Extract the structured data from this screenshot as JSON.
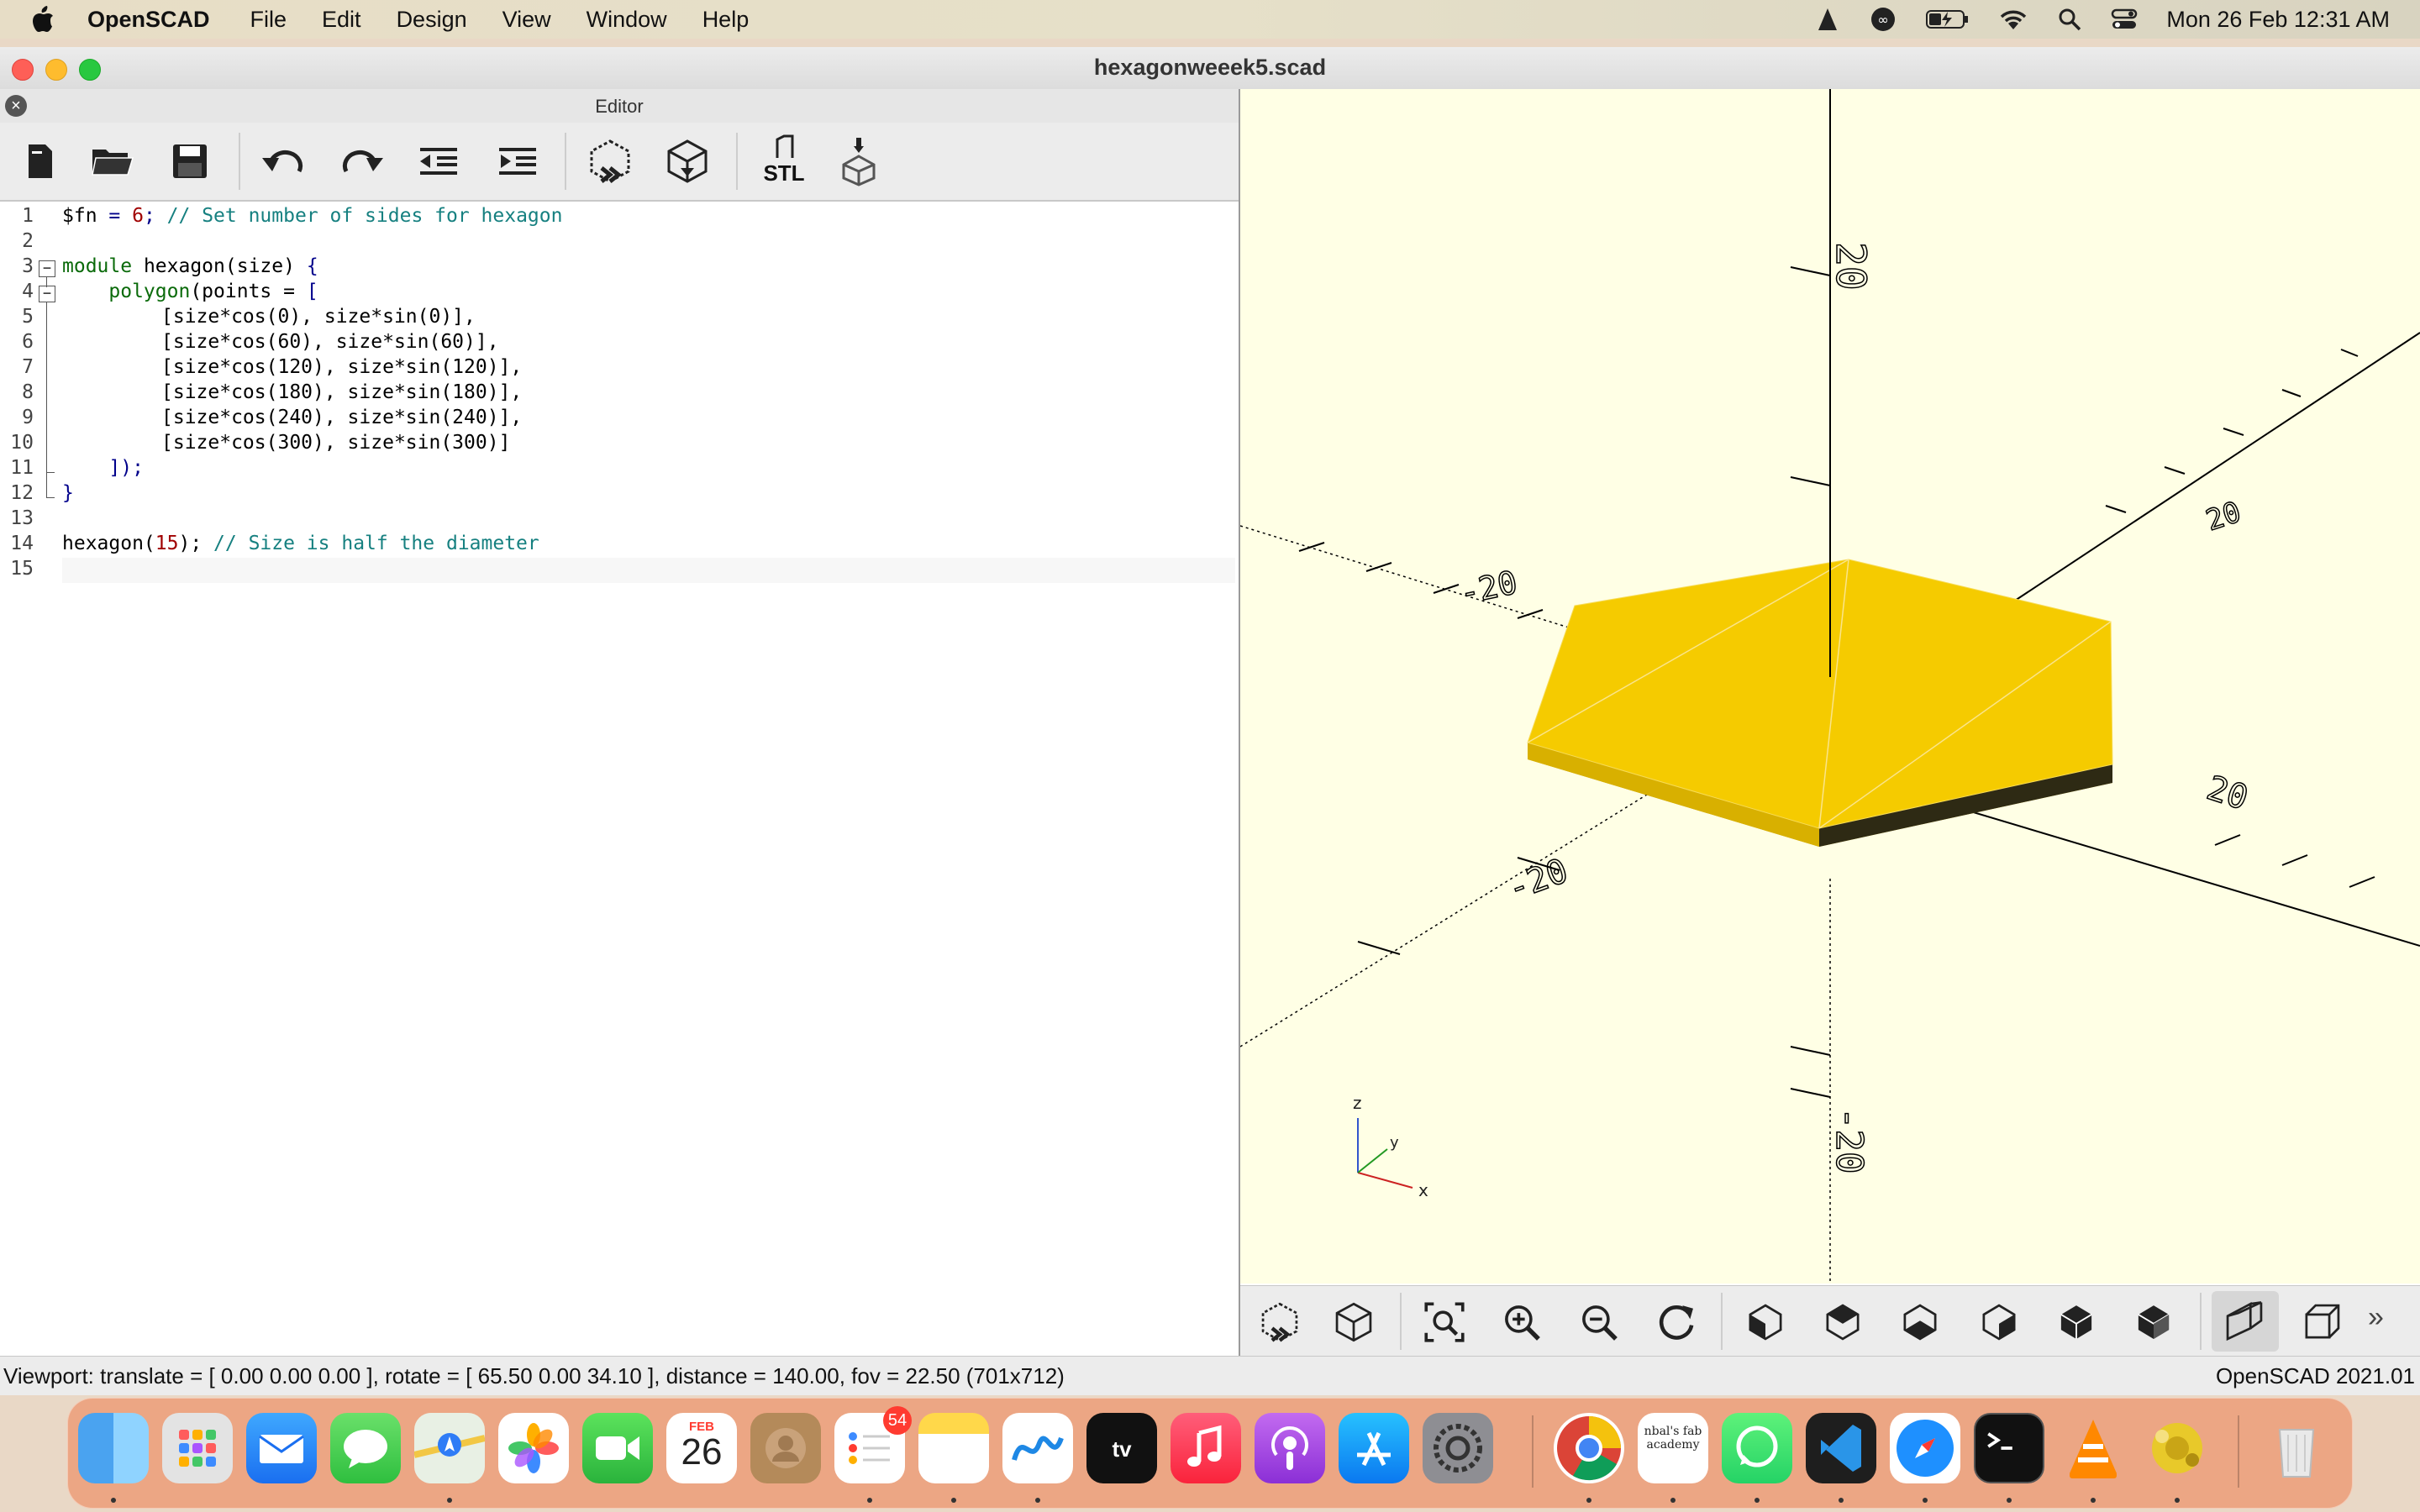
{
  "menubar": {
    "app": "OpenSCAD",
    "items": [
      "File",
      "Edit",
      "Design",
      "View",
      "Window",
      "Help"
    ],
    "datetime": "Mon 26 Feb  12:31 AM"
  },
  "window": {
    "title": "hexagonweeek5.scad"
  },
  "editor": {
    "pane_title": "Editor",
    "line_numbers": [
      "1",
      "2",
      "3",
      "4",
      "5",
      "6",
      "7",
      "8",
      "9",
      "10",
      "11",
      "12",
      "13",
      "14",
      "15"
    ]
  },
  "viewer": {
    "axis_z": "z",
    "axis_y": "y",
    "axis_x": "x",
    "labels": [
      "20",
      "-20",
      "20",
      "-20",
      "20",
      "-20"
    ]
  },
  "status": {
    "viewport": "Viewport: translate = [ 0.00 0.00 0.00 ], rotate = [ 65.50 0.00 34.10 ], distance = 140.00, fov = 22.50 (701x712)",
    "version": "OpenSCAD 2021.01"
  },
  "toolbar": {
    "stl_label": "STL"
  },
  "dock": {
    "calendar_month": "FEB",
    "calendar_day": "26",
    "reminders_badge": "54",
    "notes_tile_text": "nbal's fab academy"
  },
  "colors": {
    "viewer_bg": "#ffffe5",
    "hexagon": "#f5cb00",
    "comment": "#168080",
    "number": "#a00000",
    "keyword": "#0a6a0a"
  },
  "code": {
    "l1a": "$fn ",
    "l1b": "= ",
    "l1c": "6",
    "l1d": "; ",
    "l1e": "// Set number of sides for hexagon",
    "l3a": "module",
    "l3b": " hexagon(size) ",
    "l3c": "{",
    "l4a": "    polygon",
    "l4b": "(points = ",
    "l4c": "[",
    "l5": "[size*cos(0), size*sin(0)],",
    "l6": "[size*cos(60), size*sin(60)],",
    "l7": "[size*cos(120), size*sin(120)],",
    "l8": "[size*cos(180), size*sin(180)],",
    "l9": "[size*cos(240), size*sin(240)],",
    "l10": "[size*cos(300), size*sin(300)]",
    "l11": "    ]);",
    "l12": "}",
    "l14a": "hexagon(",
    "l14b": "15",
    "l14c": "); ",
    "l14d": "// Size is half the diameter"
  }
}
